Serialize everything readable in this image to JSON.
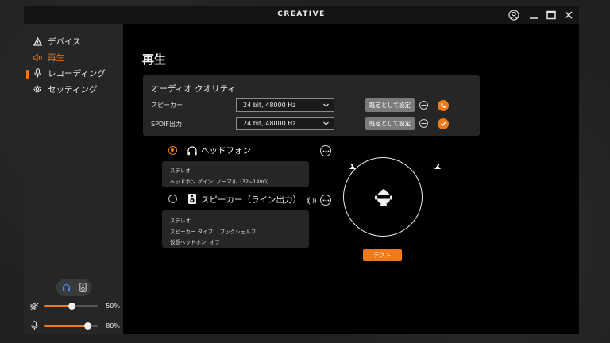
{
  "app": {
    "brand": "CREATIVE"
  },
  "titlebar": {
    "buttons": [
      {
        "name": "account-icon"
      },
      {
        "name": "minimize-icon"
      },
      {
        "name": "maximize-icon"
      },
      {
        "name": "close-icon"
      }
    ]
  },
  "sidebar": {
    "items": [
      {
        "label": "デバイス",
        "icon": "device-icon",
        "active": false
      },
      {
        "label": "再生",
        "icon": "playback-icon",
        "active": true
      },
      {
        "label": "レコーディング",
        "icon": "microphone-icon",
        "active": false
      },
      {
        "label": "セッティング",
        "icon": "gear-icon",
        "active": false
      }
    ],
    "mode_toggle": {
      "left_icon": "headphone-icon",
      "right_icon": "speaker-icon"
    },
    "sliders": [
      {
        "icon": "speaker-volume-icon",
        "value_label": "50%",
        "value": 0.5
      },
      {
        "icon": "microphone-icon",
        "value_label": "80%",
        "value": 0.8
      }
    ]
  },
  "main": {
    "title": "再生",
    "quality": {
      "title": "オーディオ クオリティ",
      "rows": [
        {
          "label": "スピーカー",
          "value": "24 bit, 48000 Hz",
          "default_label": "既定として設定",
          "status": "speaker-active"
        },
        {
          "label": "SPDIF出力",
          "value": "24 bit, 48000 Hz",
          "default_label": "既定として設定",
          "status": "checked"
        }
      ]
    },
    "outputs": [
      {
        "label": "ヘッドフォン",
        "selected": true,
        "icon": "headphone-icon",
        "details": [
          "ステレオ",
          "ヘッドホン ゲイン: ノーマル（32~149Ω）"
        ]
      },
      {
        "label": "スピーカー（ライン出力）",
        "selected": false,
        "icon": "speaker-icon",
        "details": [
          "ステレオ",
          "スピーカー タイプ:　ブックシェルフ",
          "仮想ヘッドホン: オフ"
        ]
      }
    ],
    "test_label": "テスト"
  },
  "colors": {
    "accent": "#f07a1a",
    "panel": "#262626",
    "background": "#000000"
  }
}
